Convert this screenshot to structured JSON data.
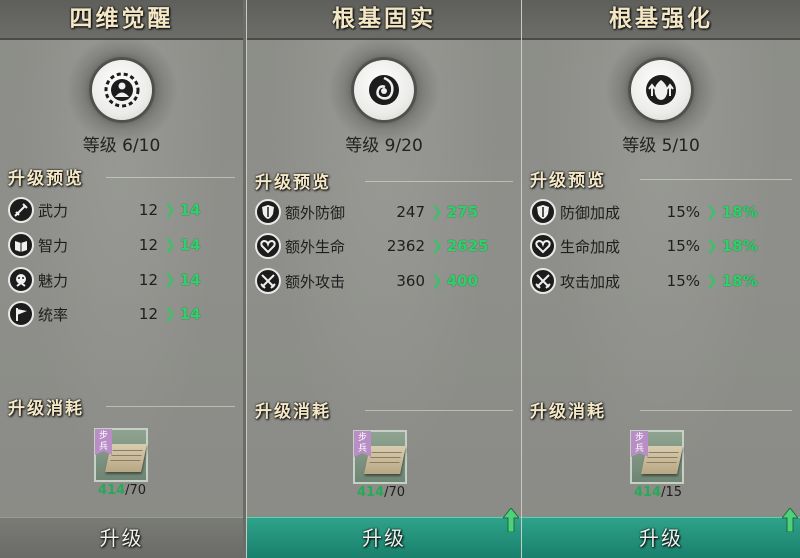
{
  "panels": [
    {
      "title": "四维觉醒",
      "emblem_icon": "awaken-person-icon",
      "level_label": "等级",
      "level_value": "6/10",
      "preview_title": "升级预览",
      "stats": [
        {
          "icon": "force-icon",
          "name": "武力",
          "old": "12",
          "new": "14"
        },
        {
          "icon": "intellect-icon",
          "name": "智力",
          "old": "12",
          "new": "14"
        },
        {
          "icon": "charm-icon",
          "name": "魅力",
          "old": "12",
          "new": "14"
        },
        {
          "icon": "command-icon",
          "name": "统率",
          "old": "12",
          "new": "14"
        }
      ],
      "cost_title": "升级消耗",
      "item_tag": "步兵",
      "cost_have": "414",
      "cost_need": "/70",
      "button_label": "升级",
      "button_active": false
    },
    {
      "title": "根基固实",
      "emblem_icon": "foundation-swirl-icon",
      "level_label": "等级",
      "level_value": "9/20",
      "preview_title": "升级预览",
      "stats": [
        {
          "icon": "defense-icon",
          "name": "额外防御",
          "old": "247",
          "new": "275"
        },
        {
          "icon": "life-icon",
          "name": "额外生命",
          "old": "2362",
          "new": "2625"
        },
        {
          "icon": "attack-icon",
          "name": "额外攻击",
          "old": "360",
          "new": "400"
        }
      ],
      "cost_title": "升级消耗",
      "item_tag": "步兵",
      "cost_have": "414",
      "cost_need": "/70",
      "button_label": "升级",
      "button_active": true
    },
    {
      "title": "根基强化",
      "emblem_icon": "foundation-boost-icon",
      "level_label": "等级",
      "level_value": "5/10",
      "preview_title": "升级预览",
      "stats": [
        {
          "icon": "defense-icon",
          "name": "防御加成",
          "old": "15%",
          "new": "18%"
        },
        {
          "icon": "life-icon",
          "name": "生命加成",
          "old": "15%",
          "new": "18%"
        },
        {
          "icon": "attack-icon",
          "name": "攻击加成",
          "old": "15%",
          "new": "18%"
        }
      ],
      "cost_title": "升级消耗",
      "item_tag": "步兵",
      "cost_have": "414",
      "cost_need": "/15",
      "button_label": "升级",
      "button_active": true
    }
  ],
  "colors": {
    "title_gold": "#f3e7c6",
    "increase_green": "#2fd06a",
    "active_button": "#2fa28a",
    "inactive_button": "#7a7b77"
  }
}
